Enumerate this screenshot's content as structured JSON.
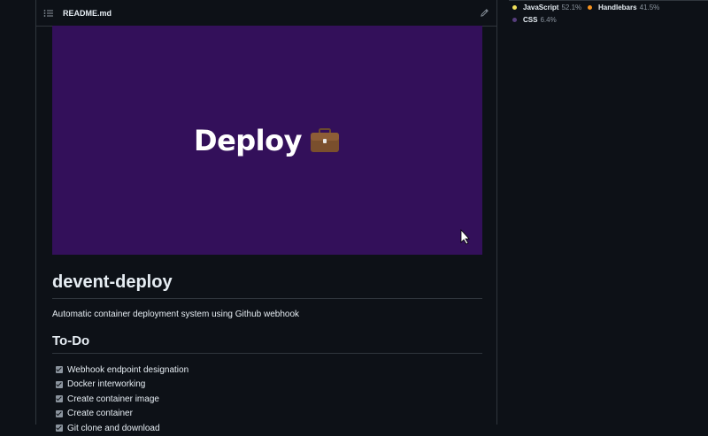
{
  "readme": {
    "filename": "README.md"
  },
  "banner": {
    "text": "Deploy"
  },
  "content": {
    "title": "devent-deploy",
    "description": "Automatic container deployment system using Github webhook",
    "todo_heading": "To-Do",
    "todos": [
      "Webhook endpoint designation",
      "Docker interworking",
      "Create container image",
      "Create container",
      "Git clone and download"
    ]
  },
  "languages": [
    {
      "name": "JavaScript",
      "percent": "52.1%",
      "color": "#f1e05a"
    },
    {
      "name": "Handlebars",
      "percent": "41.5%",
      "color": "#f7931e"
    },
    {
      "name": "CSS",
      "percent": "6.4%",
      "color": "#563d7c"
    }
  ],
  "colors": {
    "banner_bg": "#33105a",
    "page_bg": "#0d1117",
    "border": "#30363d"
  }
}
